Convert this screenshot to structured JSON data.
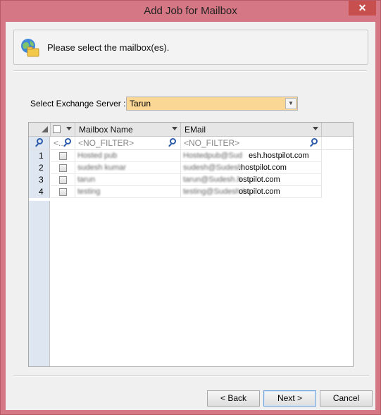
{
  "window": {
    "title": "Add Job for Mailbox",
    "close_glyph": "✕"
  },
  "header": {
    "icon": "globe-folder-icon",
    "instruction": "Please select the mailbox(es)."
  },
  "server": {
    "label": "Select Exchange Server :",
    "value": "Tarun",
    "highlight_color": "#fbd795"
  },
  "grid": {
    "columns": [
      "Mailbox Name",
      "EMail"
    ],
    "filter": {
      "check_col": "<..",
      "mailbox": "<NO_FILTER>",
      "email": "<NO_FILTER>"
    },
    "rows": [
      {
        "num": "1",
        "name": "Hosted pub",
        "email_hidden": "Hostedpub@Sud",
        "email_visible": "esh.hostpilot.com",
        "checked": false
      },
      {
        "num": "2",
        "name": "sudesh kumar",
        "email_hidden": "sudesh@Sudesh",
        "email_visible": ".hostpilot.com",
        "checked": false
      },
      {
        "num": "3",
        "name": "tarun",
        "email_hidden": "tarun@Sudesh.h",
        "email_visible": "ostpilot.com",
        "checked": false
      },
      {
        "num": "4",
        "name": "testing",
        "email_hidden": "testing@Sudesh.h",
        "email_visible": "ostpilot.com",
        "checked": false
      }
    ]
  },
  "buttons": {
    "back": "< Back",
    "next": "Next >",
    "cancel": "Cancel"
  }
}
